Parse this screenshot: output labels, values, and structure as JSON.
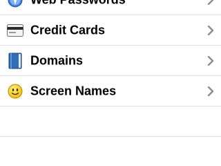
{
  "list": {
    "items": [
      {
        "label": "Web Passwords",
        "icon": "compass-icon"
      },
      {
        "label": "Credit Cards",
        "icon": "credit-card-icon"
      },
      {
        "label": "Domains",
        "icon": "book-icon"
      },
      {
        "label": "Screen Names",
        "icon": "smiley-face-icon"
      }
    ]
  },
  "colors": {
    "divider": "#e0e0e0",
    "chevron": "#8e8e8e",
    "text": "#000000"
  }
}
